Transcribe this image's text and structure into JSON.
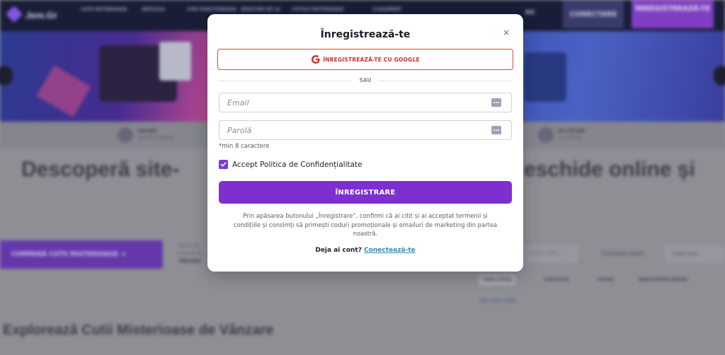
{
  "background": {
    "logo_text": "Jem.Gr",
    "nav": [
      "CUTII MISTERIOASE",
      "ARTICOLE",
      "CUM FUNCTIONEAZA",
      "REDUCERI DE LA",
      "CUTIILE MISTERIOASE",
      "CLASAMENT"
    ],
    "lang": "RO",
    "login_label": "CONECTARE",
    "signup_label": "ÎNREGISTREAZĂ-TE",
    "stats": [
      {
        "value": "140.000",
        "label": "utilizatori înregistrați"
      },
      {
        "value": "25.170.340",
        "label": "cutii deschise"
      }
    ],
    "headline_left": "Descoperă site-",
    "headline_right": "eschide online și",
    "compare_label": "COMPARĂ CUTII MISTERIOASE  ➜",
    "side_lines": [
      "Alături de",
      "noastre ale",
      "TRECHER"
    ],
    "search_placeholder": "Caută cutia...",
    "sort_label": "Sortează după:",
    "sort_value": "Cele mai",
    "filters": [
      "TOATE CUTIILE",
      "TEHNOLOGIE",
      "GAMING",
      "ÎMBRĂCĂMINTE URBANĂ"
    ],
    "reset_link": "Vezi toate cutiile",
    "section_title": "Explorează Cutii Misterioase de Vânzare"
  },
  "modal": {
    "title": "Înregistrează-te",
    "close_symbol": "×",
    "google_label": "ÎNREGISTREAZĂ-TE CU GOOGLE",
    "divider": "SAU",
    "email_placeholder": "Email",
    "password_placeholder": "Parolă",
    "password_hint": "*min 8 caractere",
    "accept_label": "Accept Politica de Confidențialitate",
    "accept_checked": true,
    "submit_label": "ÎNREGISTRARE",
    "legal_text": "Prin apăsarea butonului „Înregistrare”, confirmi că ai citit și ai acceptat termenii și condițiile și consimți să primești coduri promoționale și emailuri de marketing din partea noastră.",
    "have_account": "Deja ai cont?",
    "login_link": "Conectează-te"
  },
  "colors": {
    "accent": "#7e2fd0",
    "google_red": "#d84a3c",
    "link": "#2d8fb0"
  },
  "icons": [
    "google-icon",
    "close-icon",
    "password-manager-icon",
    "checkbox-check-icon"
  ]
}
